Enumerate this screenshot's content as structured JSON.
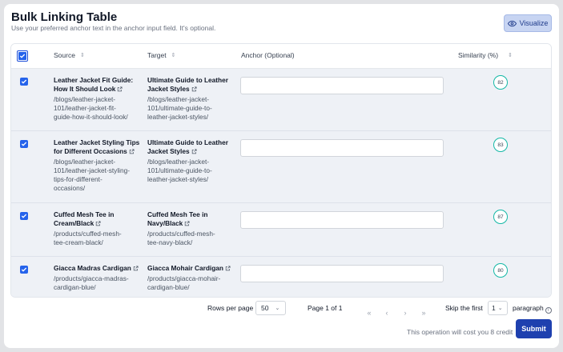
{
  "header": {
    "title": "Bulk Linking Table",
    "subtitle": "Use your preferred anchor text in the anchor input field. It's optional.",
    "visualize_label": "Visualize"
  },
  "table": {
    "columns": {
      "source": "Source",
      "target": "Target",
      "anchor": "Anchor (Optional)",
      "similarity": "Similarity (%)"
    },
    "rows": [
      {
        "source_title_1": "Leather Jacket Fit Guide:",
        "source_title_2": "How It Should Look",
        "source_path_1": "/blogs/leather-jacket-",
        "source_path_2": "101/leather-jacket-fit-",
        "source_path_3": "guide-how-it-should-look/",
        "target_title_1": "Ultimate Guide to Leather",
        "target_title_2": "Jacket Styles",
        "target_path_1": "/blogs/leather-jacket-",
        "target_path_2": "101/ultimate-guide-to-",
        "target_path_3": "leather-jacket-styles/",
        "anchor": "",
        "similarity": "82",
        "checked": true
      },
      {
        "source_title_1": "Leather Jacket Styling Tips",
        "source_title_2": "for Different Occasions",
        "source_path_1": "/blogs/leather-jacket-",
        "source_path_2": "101/leather-jacket-styling-",
        "source_path_3": "tips-for-different-",
        "source_path_4": "occasions/",
        "target_title_1": "Ultimate Guide to Leather",
        "target_title_2": "Jacket Styles",
        "target_path_1": "/blogs/leather-jacket-",
        "target_path_2": "101/ultimate-guide-to-",
        "target_path_3": "leather-jacket-styles/",
        "anchor": "",
        "similarity": "83",
        "checked": true
      },
      {
        "source_title_1": "Cuffed Mesh Tee in",
        "source_title_2": "Cream/Black",
        "source_path_1": "/products/cuffed-mesh-",
        "source_path_2": "tee-cream-black/",
        "target_title_1": "Cuffed Mesh Tee in",
        "target_title_2": "Navy/Black",
        "target_path_1": "/products/cuffed-mesh-",
        "target_path_2": "tee-navy-black/",
        "anchor": "",
        "similarity": "87",
        "checked": true
      },
      {
        "source_title_1": "Giacca Madras Cardigan",
        "source_path_1": "/products/giacca-madras-",
        "source_path_2": "cardigan-blue/",
        "target_title_1": "Giacca Mohair Cardigan",
        "target_path_1": "/products/giacca-mohair-",
        "target_path_2": "cardigan-blue/",
        "anchor": "",
        "similarity": "80",
        "checked": true
      }
    ]
  },
  "footer": {
    "rows_per_page_label": "Rows per page",
    "rows_per_page_value": "50",
    "page_info": "Page 1 of 1",
    "skip_label": "Skip the first",
    "skip_value": "1",
    "skip_unit": "paragraph",
    "cost_text": "This operation will cost you 8 credit",
    "submit_label": "Submit"
  },
  "colors": {
    "accent": "#2563eb",
    "submit": "#1e40af",
    "similarity_ring": "#14b8a6",
    "row_bg": "#eef1f6"
  }
}
